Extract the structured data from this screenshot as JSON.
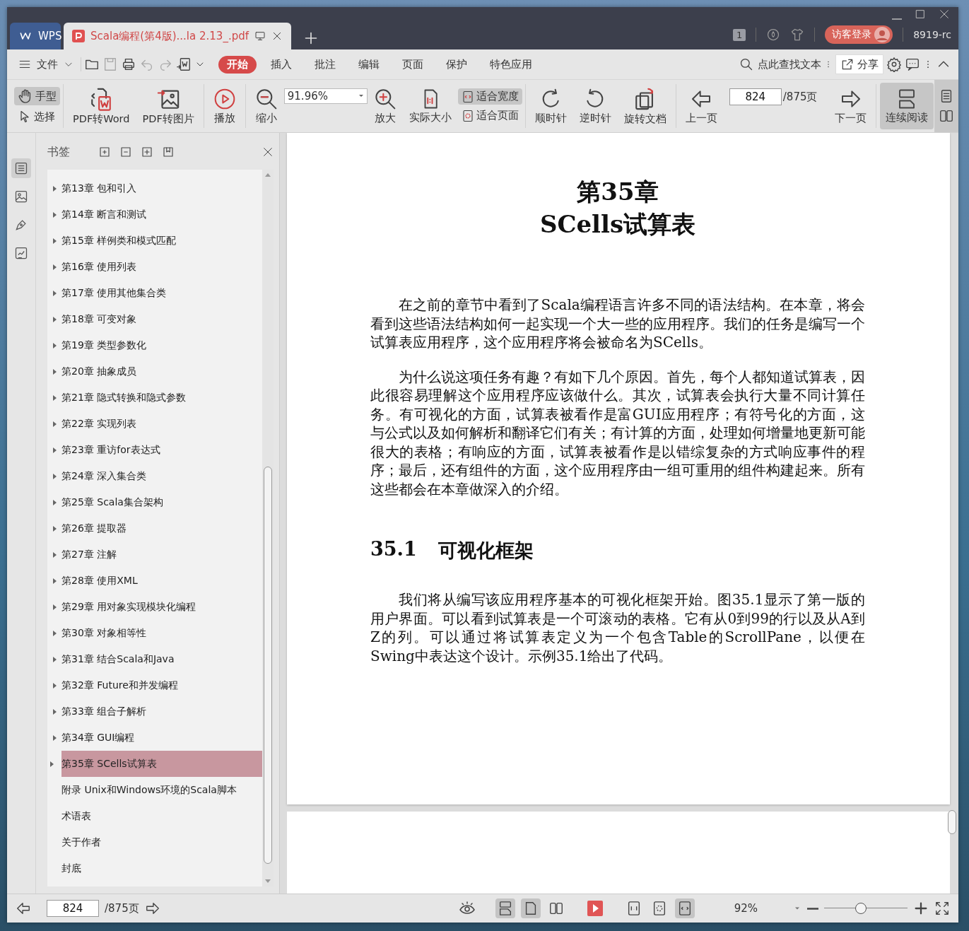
{
  "tabs": [
    {
      "kind": "home",
      "label": "WPS",
      "selected": false
    },
    {
      "kind": "document",
      "label": "Scala编程(第4版)...la 2.13_.pdf",
      "selected": true
    }
  ],
  "title_bar": {
    "page_badge": "1",
    "login": "访客登录",
    "user": "8919-rc"
  },
  "menu": {
    "file": "文件",
    "tabs": [
      {
        "label": "开始",
        "selected": true
      },
      {
        "label": "插入",
        "selected": false
      },
      {
        "label": "批注",
        "selected": false
      },
      {
        "label": "编辑",
        "selected": false
      },
      {
        "label": "页面",
        "selected": false
      },
      {
        "label": "保护",
        "selected": false
      },
      {
        "label": "特色应用",
        "selected": false
      }
    ],
    "search_placeholder": "点此查找文本",
    "share": "分享"
  },
  "ribbon": [
    {
      "kind": "pair",
      "items": [
        {
          "label": "手型",
          "selected": true
        },
        {
          "label": "选择",
          "selected": false
        }
      ]
    },
    {
      "kind": "button",
      "label": "PDF转Word",
      "selected": false
    },
    {
      "kind": "button",
      "label": "PDF转图片",
      "selected": false
    },
    {
      "kind": "button",
      "label": "播放",
      "selected": false
    },
    {
      "kind": "button",
      "label": "缩小",
      "selected": false
    },
    {
      "kind": "zoom",
      "value": "91.96%"
    },
    {
      "kind": "button",
      "label": "放大",
      "selected": false
    },
    {
      "kind": "button",
      "label": "实际大小",
      "selected": false
    },
    {
      "kind": "pair",
      "items": [
        {
          "label": "适合宽度",
          "selected": true
        },
        {
          "label": "适合页面",
          "selected": false
        }
      ]
    },
    {
      "kind": "button",
      "label": "顺时针",
      "selected": false
    },
    {
      "kind": "button",
      "label": "逆时针",
      "selected": false
    },
    {
      "kind": "button",
      "label": "旋转文档",
      "selected": false
    },
    {
      "kind": "button",
      "label": "上一页",
      "selected": false
    },
    {
      "kind": "page",
      "value": "824",
      "total": "/875页"
    },
    {
      "kind": "button",
      "label": "下一页",
      "selected": false
    },
    {
      "kind": "button",
      "label": "连续阅读",
      "selected": true
    }
  ],
  "rail": [
    {
      "selected": true
    },
    {
      "selected": false
    },
    {
      "selected": false
    },
    {
      "selected": false
    }
  ],
  "bookmarks": {
    "title": "书签",
    "items": [
      {
        "label": "第13章 包和引入",
        "collapsible": true,
        "selected": false
      },
      {
        "label": "第14章 断言和测试",
        "collapsible": true,
        "selected": false
      },
      {
        "label": "第15章 样例类和模式匹配",
        "collapsible": true,
        "selected": false
      },
      {
        "label": "第16章 使用列表",
        "collapsible": true,
        "selected": false
      },
      {
        "label": "第17章 使用其他集合类",
        "collapsible": true,
        "selected": false
      },
      {
        "label": "第18章 可变对象",
        "collapsible": true,
        "selected": false
      },
      {
        "label": "第19章 类型参数化",
        "collapsible": true,
        "selected": false
      },
      {
        "label": "第20章 抽象成员",
        "collapsible": true,
        "selected": false
      },
      {
        "label": "第21章 隐式转换和隐式参数",
        "collapsible": true,
        "selected": false
      },
      {
        "label": "第22章 实现列表",
        "collapsible": true,
        "selected": false
      },
      {
        "label": "第23章 重访for表达式",
        "collapsible": true,
        "selected": false
      },
      {
        "label": "第24章 深入集合类",
        "collapsible": true,
        "selected": false
      },
      {
        "label": "第25章 Scala集合架构",
        "collapsible": true,
        "selected": false
      },
      {
        "label": "第26章 提取器",
        "collapsible": true,
        "selected": false
      },
      {
        "label": "第27章 注解",
        "collapsible": true,
        "selected": false
      },
      {
        "label": "第28章 使用XML",
        "collapsible": true,
        "selected": false
      },
      {
        "label": "第29章 用对象实现模块化编程",
        "collapsible": true,
        "selected": false
      },
      {
        "label": "第30章 对象相等性",
        "collapsible": true,
        "selected": false
      },
      {
        "label": "第31章 结合Scala和Java",
        "collapsible": true,
        "selected": false
      },
      {
        "label": "第32章 Future和并发编程",
        "collapsible": true,
        "selected": false
      },
      {
        "label": "第33章 组合子解析",
        "collapsible": true,
        "selected": false
      },
      {
        "label": "第34章 GUI编程",
        "collapsible": true,
        "selected": false
      },
      {
        "label": "第35章 SCells试算表",
        "collapsible": true,
        "selected": true
      },
      {
        "label": "附录 Unix和Windows环境的Scala脚本",
        "collapsible": false,
        "selected": false
      },
      {
        "label": "术语表",
        "collapsible": false,
        "selected": false
      },
      {
        "label": "关于作者",
        "collapsible": false,
        "selected": false
      },
      {
        "label": "封底",
        "collapsible": false,
        "selected": false
      }
    ]
  },
  "page": {
    "chapter_number": "第35章",
    "chapter_title": "SCells试算表",
    "paragraphs": [
      "在之前的章节中看到了Scala编程语言许多不同的语法结构。在本章，将会看到这些语法结构如何一起实现一个大一些的应用程序。我们的任务是编写一个试算表应用程序，这个应用程序将会被命名为SCells。",
      "为什么说这项任务有趣？有如下几个原因。首先，每个人都知道试算表，因此很容易理解这个应用程序应该做什么。其次，试算表会执行大量不同计算任务。有可视化的方面，试算表被看作是富GUI应用程序；有符号化的方面，这与公式以及如何解析和翻译它们有关；有计算的方面，处理如何增量地更新可能很大的表格；有响应的方面，试算表被看作是以错综复杂的方式响应事件的程序；最后，还有组件的方面，这个应用程序由一组可重用的组件构建起来。所有这些都会在本章做深入的介绍。"
    ],
    "section_number": "35.1",
    "section_title": "可视化框架",
    "section_paragraphs": [
      "我们将从编写该应用程序基本的可视化框架开始。图35.1显示了第一版的用户界面。可以看到试算表是一个可滚动的表格。它有从0到99的行以及从A到Z的列。可以通过将试算表定义为一个包含Table的ScrollPane，以便在Swing中表达这个设计。示例35.1给出了代码。"
    ]
  },
  "bottom_bar": {
    "page": "824",
    "total": "/875页",
    "view_modes": [
      {
        "selected": true
      },
      {
        "selected": true
      },
      {
        "selected": false
      }
    ],
    "fit_modes": [
      {
        "selected": false
      },
      {
        "selected": false
      },
      {
        "selected": true
      }
    ],
    "zoom": "92%",
    "zoom_slider": {
      "level": 0.44
    }
  }
}
